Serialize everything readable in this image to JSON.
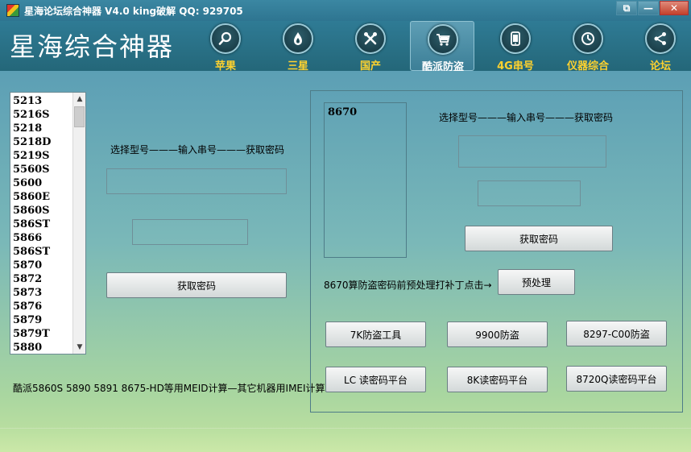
{
  "window": {
    "title": "星海论坛综合神器 V4.0  king破解  QQ: 929705",
    "controls": {
      "restore": "⧉",
      "minimize": "—",
      "close": "✕"
    }
  },
  "header": {
    "brand": "星海综合神器",
    "nav": [
      {
        "label": "苹果",
        "icon": "search-icon"
      },
      {
        "label": "三星",
        "icon": "flame-icon"
      },
      {
        "label": "国产",
        "icon": "tools-icon"
      },
      {
        "label": "酷派防盗",
        "icon": "cart-icon",
        "active": true
      },
      {
        "label": "4G串号",
        "icon": "phone-icon"
      },
      {
        "label": "仪器综合",
        "icon": "gauge-icon"
      },
      {
        "label": "论坛",
        "icon": "share-icon"
      }
    ]
  },
  "left": {
    "models": [
      "5213",
      "5216S",
      "5218",
      "5218D",
      "5219S",
      "5560S",
      "5600",
      "5860E",
      "5860S",
      "586ST",
      "5866",
      "586ST",
      "5870",
      "5872",
      "5873",
      "5876",
      "5879",
      "5879T",
      "5880"
    ],
    "instruction": "选择型号———输入串号———获取密码",
    "input1": "",
    "input2": "",
    "get_pwd_button": "获取密码",
    "footer_note": "酷派5860S 5890 5891 8675-HD等用MEID计算—其它机器用IMEI计算!"
  },
  "right": {
    "memo": "8670",
    "instruction": "选择型号———输入串号———获取密码",
    "input1": "",
    "input2": "",
    "get_pwd_button": "获取密码",
    "preprocess_note": "8670算防盗密码前预处理打补丁点击→",
    "preprocess_button": "预处理",
    "tools": [
      "7K防盗工具",
      "9900防盗",
      "8297-C00防盗",
      "LC 读密码平台",
      "8K读密码平台",
      "8720Q读密码平台"
    ]
  },
  "colors": {
    "accent_nav": "#ffd22e",
    "header": "#2a6f86"
  }
}
